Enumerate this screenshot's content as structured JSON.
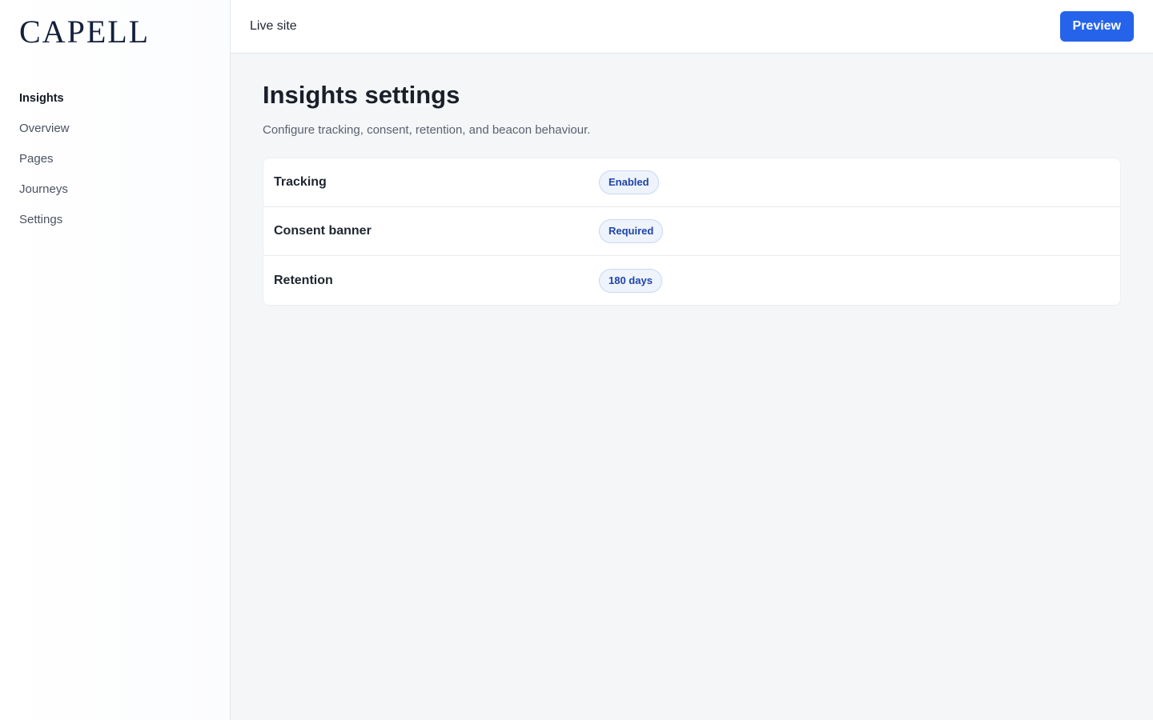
{
  "brand": {
    "name": "CAPELL"
  },
  "sidebar": {
    "items": [
      {
        "label": "Insights",
        "active": true
      },
      {
        "label": "Overview",
        "active": false
      },
      {
        "label": "Pages",
        "active": false
      },
      {
        "label": "Journeys",
        "active": false
      },
      {
        "label": "Settings",
        "active": false
      }
    ]
  },
  "topbar": {
    "site_label": "Live site",
    "preview_label": "Preview"
  },
  "main": {
    "title": "Insights settings",
    "subtitle": "Configure tracking, consent, retention, and beacon behaviour.",
    "settings": [
      {
        "label": "Tracking",
        "value": "Enabled"
      },
      {
        "label": "Consent banner",
        "value": "Required"
      },
      {
        "label": "Retention",
        "value": "180 days"
      }
    ]
  },
  "colors": {
    "accent": "#2563eb",
    "badge_text": "#1e45a8",
    "badge_bg": "#eef3fc",
    "brand": "#13213b"
  }
}
